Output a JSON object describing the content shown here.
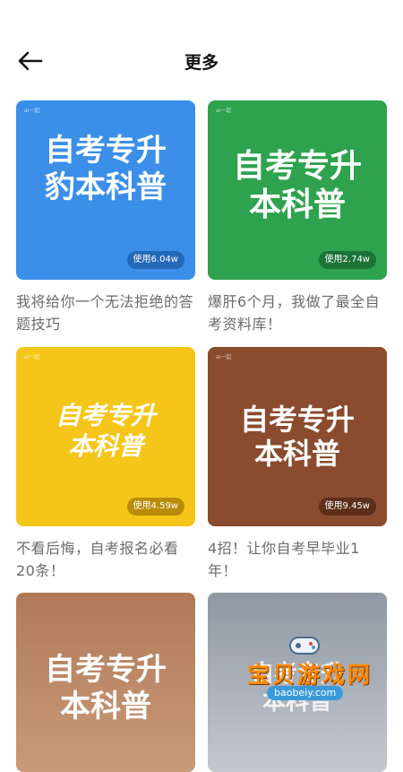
{
  "header": {
    "title": "更多",
    "back_icon": "arrow-left-icon"
  },
  "cards": [
    {
      "tag": "ai一起",
      "cover_title": [
        "自考专升",
        "豹本科普"
      ],
      "usage": "使用6.04w",
      "caption": "我将给你一个无法拒绝的答题技巧",
      "bg": "#3b8fe8",
      "badge_bg": "#2468b8"
    },
    {
      "tag": "ai一起",
      "cover_title": [
        "自考专升",
        "本科普"
      ],
      "usage": "使用2.74w",
      "caption": "爆肝6个月，我做了最全自考资料库！",
      "bg": "#2ea24e",
      "badge_bg": "#1d7336"
    },
    {
      "tag": "ai一起",
      "cover_title": [
        "自考专升",
        "本科普"
      ],
      "usage": "使用4.59w",
      "caption": "不看后悔，自考报名必看20条！",
      "bg": "#f5c619",
      "badge_bg": "#b88c07"
    },
    {
      "tag": "ai一起",
      "cover_title": [
        "自考专升",
        "本科普"
      ],
      "usage": "使用9.45w",
      "caption": "4招！让你自考早毕业1年！",
      "bg": "#8a4b2e",
      "badge_bg": "#5c2f1a"
    },
    {
      "tag": "",
      "cover_title": [
        "自考专升",
        "本科普"
      ],
      "usage": "",
      "caption": "",
      "bg": "#b98364",
      "badge_bg": "#8b5d42"
    },
    {
      "tag": "",
      "cover_title": [
        "自考专升",
        "本科普"
      ],
      "usage": "",
      "caption": "",
      "bg": "#9aa3ad",
      "badge_bg": "#6d7680"
    }
  ],
  "watermark": {
    "text": "宝贝游戏网",
    "sub": "baobeiy.com"
  }
}
